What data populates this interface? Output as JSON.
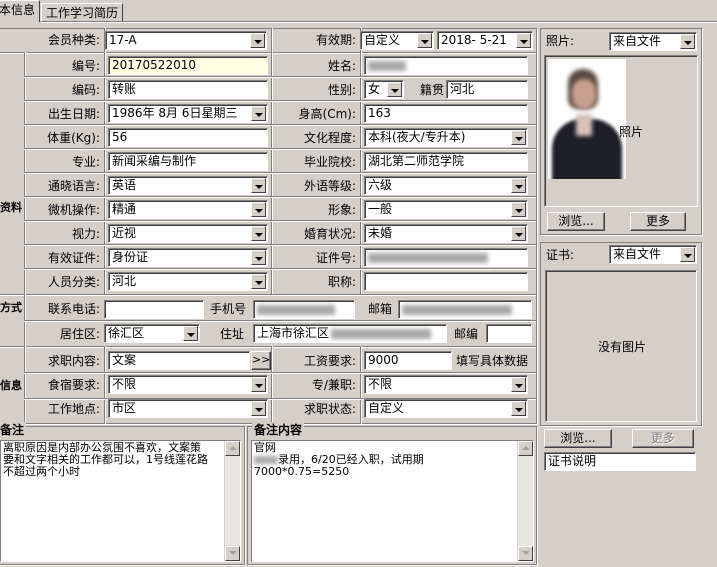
{
  "tabs": [
    {
      "label": "本信息"
    },
    {
      "label": "工作学习简历"
    }
  ],
  "top": {
    "member_type_label": "会员种类:",
    "member_type_value": "17-A",
    "validity_label": "有效期:",
    "validity_mode": "自定义",
    "validity_date": "2018- 5-21"
  },
  "basic": {
    "section_label": "资料",
    "id_label": "编号:",
    "id_value": "20170522010",
    "name_label": "姓名:",
    "code_label": "编码:",
    "code_value": "转账",
    "gender_label": "性别:",
    "gender_value": "女",
    "native_label": "籍贯",
    "native_value": "河北",
    "birth_label": "出生日期:",
    "birth_value": "1986年 8月 6日星期三",
    "height_label": "身高(Cm):",
    "height_value": "163",
    "weight_label": "体重(Kg):",
    "weight_value": "56",
    "edu_label": "文化程度:",
    "edu_value": "本科(夜大/专升本)",
    "major_label": "专业:",
    "major_value": "新闻采编与制作",
    "school_label": "毕业院校:",
    "school_value": "湖北第二师范学院",
    "lang_label": "通晓语言:",
    "lang_value": "英语",
    "lang_level_label": "外语等级:",
    "lang_level_value": "六级",
    "pc_label": "微机操作:",
    "pc_value": "精通",
    "image_label": "形象:",
    "image_value": "一般",
    "vision_label": "视力:",
    "vision_value": "近视",
    "marital_label": "婚育状况:",
    "marital_value": "未婚",
    "doc_label": "有效证件:",
    "doc_value": "身份证",
    "cert_no_label": "证件号:",
    "category_label": "人员分类:",
    "category_value": "河北",
    "title_label": "职称:"
  },
  "contact": {
    "section_label": "方式",
    "phone_label": "联系电话:",
    "mobile_label": "手机号",
    "email_label": "邮箱",
    "district_label": "居住区:",
    "district_value": "徐汇区",
    "address_label": "住址",
    "address_value": "上海市徐汇区",
    "postcode_label": "邮编"
  },
  "job": {
    "section_label": "信息",
    "want_label": "求职内容:",
    "want_value": "文案",
    "more_btn": ">>",
    "salary_label": "工资要求:",
    "salary_value": "9000",
    "salary_hint": "填写具体数据",
    "board_label": "食宿要求:",
    "board_value": "不限",
    "fulltime_label": "专/兼职:",
    "fulltime_value": "不限",
    "place_label": "工作地点:",
    "place_value": "市区",
    "status_label": "求职状态:",
    "status_value": "自定义"
  },
  "notes": {
    "left_title": "备注",
    "left_text": "离职原因是内部办公氛围不喜欢，文案策\n要和文字相关的工作都可以，1号线莲花路\n不超过两个小时",
    "right_title": "备注内容",
    "right_line1": "官网",
    "right_line2": "录用，6/20已经入职，试用期",
    "right_line3": "7000*0.75=5250"
  },
  "photo": {
    "label": "照片:",
    "source": "来自文件",
    "caption": "照片",
    "browse_btn": "浏览...",
    "more_btn": "更多"
  },
  "cert": {
    "label": "证书:",
    "source": "来自文件",
    "no_image": "没有图片",
    "browse_btn": "浏览...",
    "more_btn": "更多",
    "desc": "证书说明"
  }
}
